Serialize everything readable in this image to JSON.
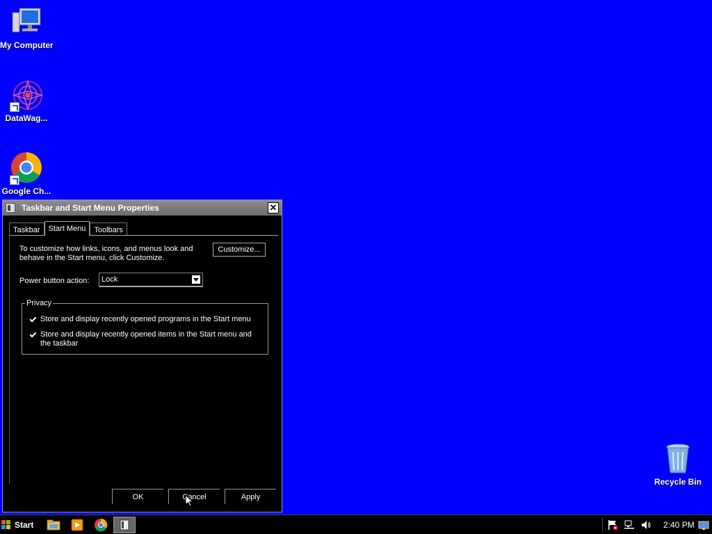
{
  "desktop": {
    "icons": [
      {
        "label": "My Computer",
        "icon": "my-computer-icon"
      },
      {
        "label": "DataWag...",
        "icon": "datawag-icon"
      },
      {
        "label": "Google Ch...",
        "icon": "chrome-icon"
      },
      {
        "label": "Recycle Bin",
        "icon": "recycle-bin-icon"
      }
    ],
    "background": "#0000ff"
  },
  "dialog": {
    "title": "Taskbar and Start Menu Properties",
    "close_label": "✕",
    "tabs": [
      {
        "label": "Taskbar",
        "active": false
      },
      {
        "label": "Start Menu",
        "active": true
      },
      {
        "label": "Toolbars",
        "active": false
      }
    ],
    "description": "To customize how links, icons, and menus look and behave in the Start menu, click Customize.",
    "customize_label": "Customize...",
    "power_label": "Power button action:",
    "power_value": "Lock",
    "privacy": {
      "legend": "Privacy",
      "options": [
        {
          "label": "Store and display recently opened programs in the Start menu",
          "checked": true
        },
        {
          "label": "Store and display recently opened items in the Start menu and the taskbar",
          "checked": true
        }
      ]
    },
    "buttons": {
      "ok": "OK",
      "cancel": "Cancel",
      "apply": "Apply"
    }
  },
  "taskbar": {
    "start_label": "Start",
    "pinned": [
      "folder-icon",
      "media-player-icon",
      "chrome-icon",
      "properties-window-icon"
    ],
    "tray": [
      "action-center-flag-icon",
      "network-icon",
      "volume-icon",
      "show-desktop-icon"
    ],
    "clock": "2:40 PM"
  }
}
